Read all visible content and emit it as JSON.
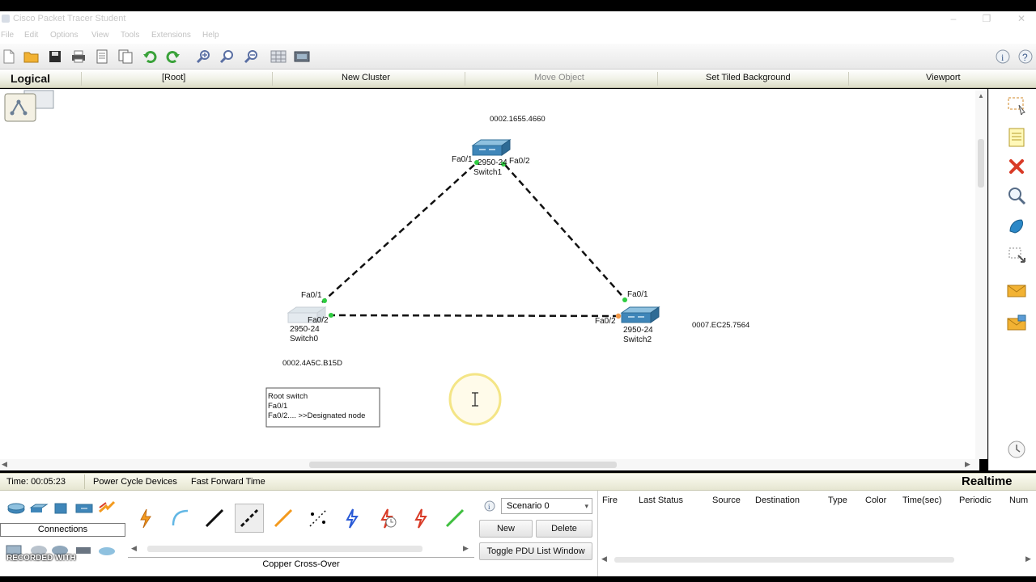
{
  "window": {
    "title": "Cisco Packet Tracer Student"
  },
  "menu": [
    "File",
    "Edit",
    "Options",
    "View",
    "Tools",
    "Extensions",
    "Help"
  ],
  "workspace_bar": {
    "mode": "Logical",
    "root": "[Root]",
    "new_cluster": "New Cluster",
    "move_object": "Move Object",
    "set_tiled_background": "Set Tiled Background",
    "viewport": "Viewport"
  },
  "topology": {
    "switch1": {
      "model": "2950-24",
      "name": "Switch1",
      "mac": "0002.1655.4660",
      "port_left": "Fa0/1",
      "port_right": "Fa0/2"
    },
    "switch0": {
      "model": "2950-24",
      "name": "Switch0",
      "mac": "0002.4A5C.B15D",
      "port_top": "Fa0/1",
      "port_right": "Fa0/2"
    },
    "switch2": {
      "model": "2950-24",
      "name": "Switch2",
      "mac": "0007.EC25.7564",
      "port_top": "Fa0/1",
      "port_left": "Fa0/2"
    },
    "note": {
      "line1": "Root switch",
      "line2": "Fa0/1",
      "line3": "Fa0/2.... >>Designated node"
    }
  },
  "status_bar": {
    "time": "Time: 00:05:23",
    "power_cycle": "Power Cycle Devices",
    "fast_forward": "Fast Forward Time",
    "mode": "Realtime"
  },
  "device_panel": {
    "category": "Connections",
    "selected_cable": "Copper Cross-Over",
    "watermark": "RECORDED WITH"
  },
  "scenario": {
    "selected": "Scenario 0",
    "new": "New",
    "delete": "Delete",
    "toggle": "Toggle PDU List Window"
  },
  "pdu_columns": [
    "Fire",
    "Last Status",
    "Source",
    "Destination",
    "Type",
    "Color",
    "Time(sec)",
    "Periodic",
    "Num"
  ],
  "colors": {
    "link": "#111111",
    "port_up": "#2ecc40",
    "port_blocking": "#f39a4a",
    "switch_body": "#3f86b9",
    "cursor_halo": "#f3e37a"
  }
}
